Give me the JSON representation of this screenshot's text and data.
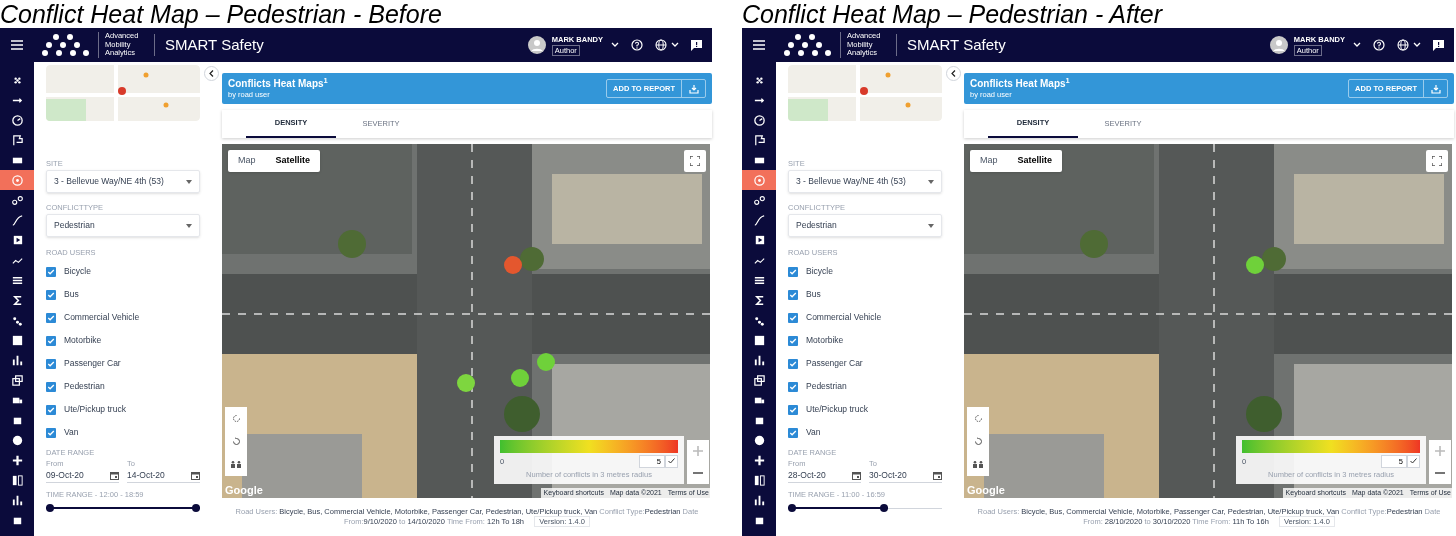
{
  "panels": [
    {
      "caption": "Conflict Heat Map – Pedestrian - Before",
      "app": {
        "brand": "Advanced Mobility Analytics",
        "title": "SMART Safety",
        "user": {
          "name": "MARK BANDY",
          "role": "Author"
        }
      },
      "nav_items": [
        {
          "selected": false
        },
        {
          "selected": false
        },
        {
          "selected": false
        },
        {
          "selected": false
        },
        {
          "selected": false
        },
        {
          "selected": true
        },
        {
          "selected": false
        },
        {
          "selected": false
        },
        {
          "selected": false
        },
        {
          "selected": false
        },
        {
          "selected": false
        },
        {
          "selected": false
        },
        {
          "selected": false
        },
        {
          "selected": false
        },
        {
          "selected": false
        },
        {
          "selected": false
        },
        {
          "selected": false
        },
        {
          "selected": false
        },
        {
          "selected": false
        },
        {
          "selected": false
        },
        {
          "selected": false
        },
        {
          "selected": false
        },
        {
          "selected": false
        }
      ],
      "filters": {
        "site": {
          "label": "SITE",
          "value": "3 - Bellevue Way/NE 4th (53)"
        },
        "conflict_type": {
          "label": "CONFLICTTYPE",
          "value": "Pedestrian"
        },
        "road_users": {
          "label": "ROAD USERS",
          "items": [
            {
              "label": "Bicycle",
              "checked": true
            },
            {
              "label": "Bus",
              "checked": true
            },
            {
              "label": "Commercial Vehicle",
              "checked": true
            },
            {
              "label": "Motorbike",
              "checked": true
            },
            {
              "label": "Passenger Car",
              "checked": true
            },
            {
              "label": "Pedestrian",
              "checked": true
            },
            {
              "label": "Ute/Pickup truck",
              "checked": true
            },
            {
              "label": "Van",
              "checked": true
            }
          ]
        },
        "date_range": {
          "label": "DATE RANGE",
          "from_label": "From",
          "from": "09-Oct-20",
          "to_label": "To",
          "to": "14-Oct-20"
        },
        "time_range": {
          "label": "TIME RANGE - 12:00 - 18:59",
          "level": 1
        }
      },
      "report": {
        "title": "Conflicts Heat Maps$^{1}$",
        "subtitle": "by road user",
        "add_button": "ADD TO REPORT"
      },
      "tabs": [
        {
          "label": "DENSITY",
          "selected": true
        },
        {
          "label": "SEVERITY",
          "selected": false
        }
      ],
      "map": {
        "type_tabs": [
          {
            "label": "Map",
            "selected": false
          },
          {
            "label": "Satellite",
            "selected": true
          }
        ],
        "heat_spots": [
          {
            "color": "#e4572e"
          },
          {
            "color": "#6fd13a"
          },
          {
            "color": "#6fd13a"
          },
          {
            "color": "#7ed63f"
          }
        ],
        "legend": {
          "min": "0",
          "max": "5",
          "caption": "Number of conflicts in 3 metres radius"
        },
        "logo": "Google",
        "attribution": [
          "Keyboard shortcuts",
          "Map data ©2021",
          "Terms of Use"
        ]
      },
      "summary": "Road Users: **Bicycle, Bus, Commercial Vehicle, Motorbike, Passenger Car, Pedestrian, Ute/Pickup truck, Van** Conflict Type:**Pedestrian** Date From:**9/10/2020** to **14/10/2020** Time From: **12h To 18h**",
      "version": "Version: 1.4.0"
    },
    {
      "caption": "Conflict Heat Map – Pedestrian - After",
      "app": {
        "brand": "Advanced Mobility Analytics",
        "title": "SMART Safety",
        "user": {
          "name": "MARK BANDY",
          "role": "Author"
        }
      },
      "nav_items": [
        {
          "selected": false
        },
        {
          "selected": false
        },
        {
          "selected": false
        },
        {
          "selected": false
        },
        {
          "selected": false
        },
        {
          "selected": true
        },
        {
          "selected": false
        },
        {
          "selected": false
        },
        {
          "selected": false
        },
        {
          "selected": false
        },
        {
          "selected": false
        },
        {
          "selected": false
        },
        {
          "selected": false
        },
        {
          "selected": false
        },
        {
          "selected": false
        },
        {
          "selected": false
        },
        {
          "selected": false
        },
        {
          "selected": false
        },
        {
          "selected": false
        },
        {
          "selected": false
        },
        {
          "selected": false
        },
        {
          "selected": false
        },
        {
          "selected": false
        }
      ],
      "filters": {
        "site": {
          "label": "SITE",
          "value": "3 - Bellevue Way/NE 4th (53)"
        },
        "conflict_type": {
          "label": "CONFLICTTYPE",
          "value": "Pedestrian"
        },
        "road_users": {
          "label": "ROAD USERS",
          "items": [
            {
              "label": "Bicycle",
              "checked": true
            },
            {
              "label": "Bus",
              "checked": true
            },
            {
              "label": "Commercial Vehicle",
              "checked": true
            },
            {
              "label": "Motorbike",
              "checked": true
            },
            {
              "label": "Passenger Car",
              "checked": true
            },
            {
              "label": "Pedestrian",
              "checked": true
            },
            {
              "label": "Ute/Pickup truck",
              "checked": true
            },
            {
              "label": "Van",
              "checked": true
            }
          ]
        },
        "date_range": {
          "label": "DATE RANGE",
          "from_label": "From",
          "from": "28-Oct-20",
          "to_label": "To",
          "to": "30-Oct-20"
        },
        "time_range": {
          "label": "TIME RANGE - 11:00 - 16:59",
          "level": 0.65
        }
      },
      "report": {
        "title": "Conflicts Heat Maps$^{1}$",
        "subtitle": "by road user",
        "add_button": "ADD TO REPORT"
      },
      "tabs": [
        {
          "label": "DENSITY",
          "selected": true
        },
        {
          "label": "SEVERITY",
          "selected": false
        }
      ],
      "map": {
        "type_tabs": [
          {
            "label": "Map",
            "selected": false
          },
          {
            "label": "Satellite",
            "selected": true
          }
        ],
        "heat_spots": [
          {
            "color": "#6fd13a"
          }
        ],
        "legend": {
          "min": "0",
          "max": "5",
          "caption": "Number of conflicts in 3 metres radius"
        },
        "logo": "Google",
        "attribution": [
          "Keyboard shortcuts",
          "Map data ©2021",
          "Terms of Use"
        ]
      },
      "summary": "Road Users: **Bicycle, Bus, Commercial Vehicle, Motorbike, Passenger Car, Pedestrian, Ute/Pickup truck, Van** Conflict Type:**Pedestrian** Date From: **28/10/2020** to **30/10/2020** Time From: **11h To 16h**",
      "version": "Version: 1.4.0"
    }
  ]
}
